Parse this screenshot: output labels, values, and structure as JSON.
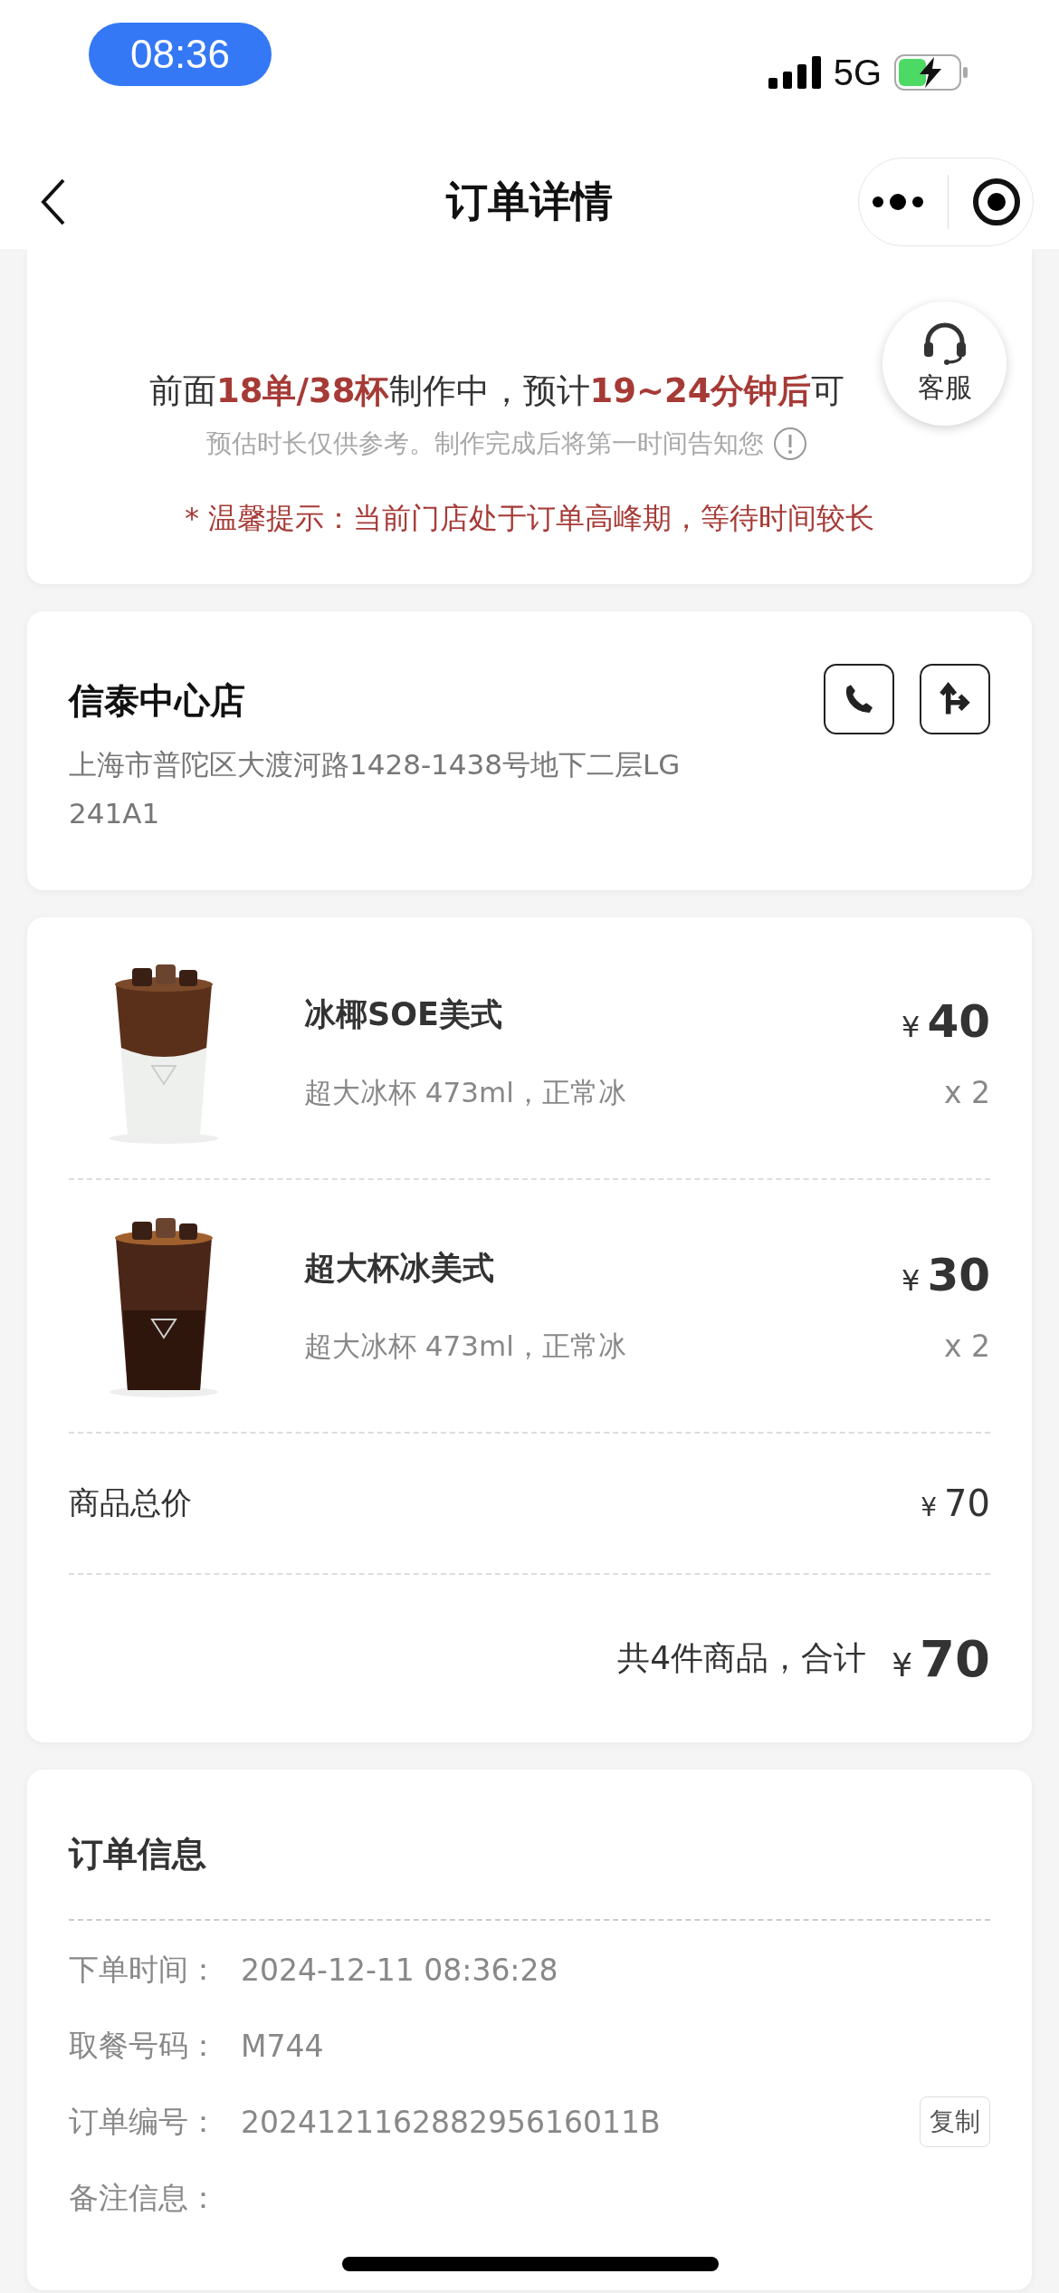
{
  "status_bar": {
    "time": "08:36",
    "network": "5G"
  },
  "nav": {
    "title": "订单详情"
  },
  "progress": {
    "headline": "前面**18单/38杯**制作中，预计**19~24分钟后**可",
    "note": "预估时长仅供参考。制作完成后将第一时间告知您",
    "tip": "* 温馨提示：当前门店处于订单高峰期，等待时间较长"
  },
  "service_button": {
    "label": "客服"
  },
  "store": {
    "name": "信泰中心店",
    "address": "上海市普陀区大渡河路1428-1438号地下二层LG 241A1"
  },
  "items": [
    {
      "name": "冰椰SOE美式",
      "options": "超大冰杯 473ml，正常冰",
      "currency": "¥",
      "price": "40",
      "quantity": "x 2",
      "kind": "layered"
    },
    {
      "name": "超大杯冰美式",
      "options": "超大冰杯 473ml，正常冰",
      "currency": "¥",
      "price": "30",
      "quantity": "x 2",
      "kind": "dark"
    }
  ],
  "subtotal": {
    "label": "商品总价",
    "currency": "¥",
    "amount": "70"
  },
  "total": {
    "label": "共4件商品，合计",
    "currency": "¥",
    "amount": "70"
  },
  "order_info": {
    "title": "订单信息",
    "rows": [
      {
        "label": "下单时间：",
        "value": "2024-12-11 08:36:28"
      },
      {
        "label": "取餐号码：",
        "value": "M744"
      },
      {
        "label": "订单编号：",
        "value": "202412116288295616011B",
        "action": "复制"
      },
      {
        "label": "备注信息：",
        "value": ""
      }
    ]
  }
}
